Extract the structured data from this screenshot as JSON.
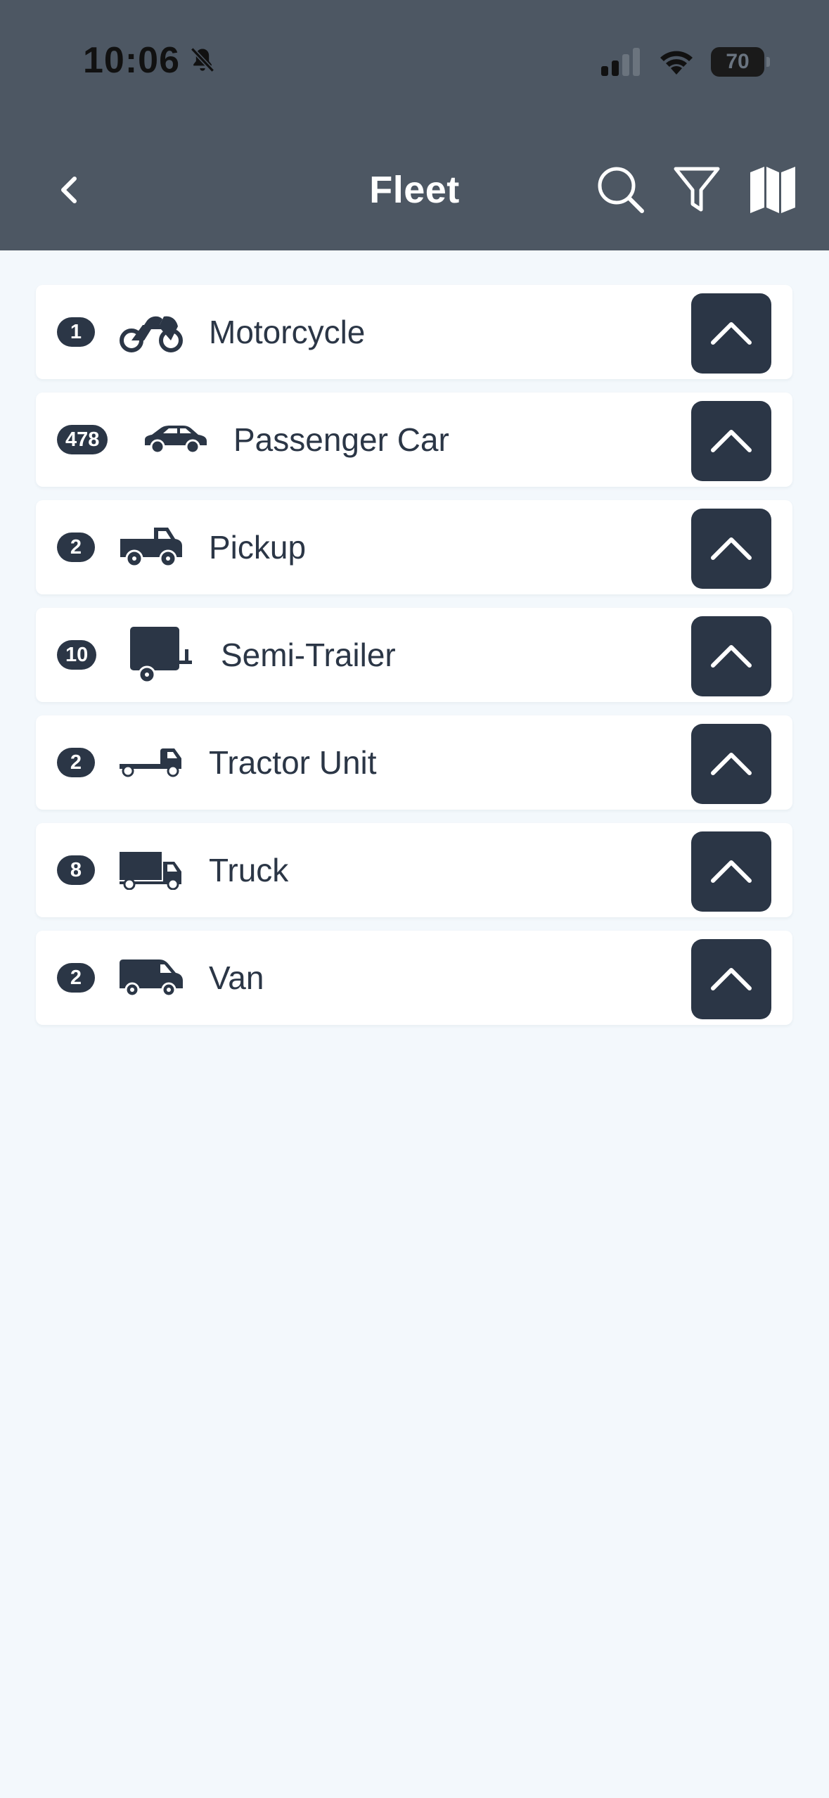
{
  "status_bar": {
    "time": "10:06",
    "battery": "70"
  },
  "header": {
    "title": "Fleet"
  },
  "fleet": [
    {
      "count": "1",
      "label": "Motorcycle",
      "icon": "motorcycle-icon"
    },
    {
      "count": "478",
      "label": "Passenger Car",
      "icon": "car-icon"
    },
    {
      "count": "2",
      "label": "Pickup",
      "icon": "pickup-icon"
    },
    {
      "count": "10",
      "label": "Semi-Trailer",
      "icon": "trailer-icon"
    },
    {
      "count": "2",
      "label": "Tractor Unit",
      "icon": "tractor-unit-icon"
    },
    {
      "count": "8",
      "label": "Truck",
      "icon": "truck-icon"
    },
    {
      "count": "2",
      "label": "Van",
      "icon": "van-icon"
    }
  ],
  "colors": {
    "header_bg": "#4d5763",
    "page_bg": "#f3f8fc",
    "accent": "#2b3646"
  }
}
